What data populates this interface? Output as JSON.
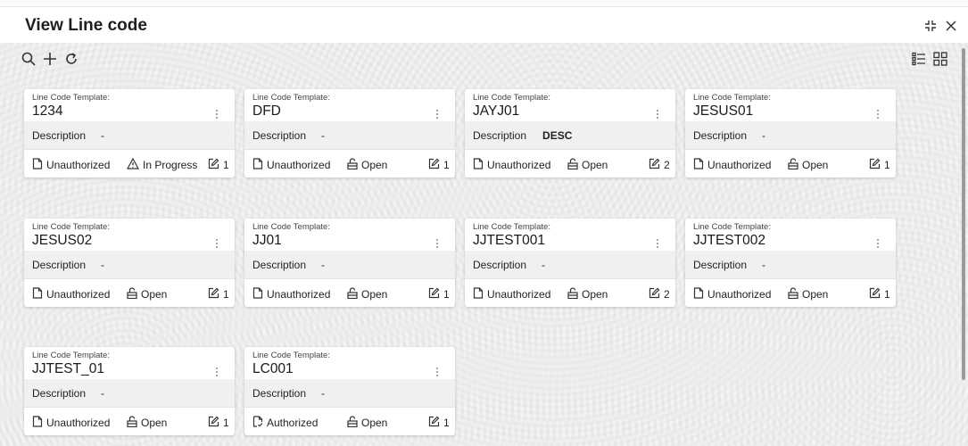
{
  "header": {
    "title": "View Line code"
  },
  "toolbar": {
    "search_icon": "search-icon",
    "add_icon": "plus-icon",
    "refresh_icon": "refresh-icon",
    "list_view_icon": "list-view-icon",
    "grid_view_icon": "grid-view-icon"
  },
  "window": {
    "minimize_icon": "collapse-icon",
    "close_icon": "close-icon"
  },
  "card_label": "Line Code Template:",
  "description_label": "Description",
  "cards": [
    {
      "code": "1234",
      "description": "-",
      "auth": "Unauthorized",
      "status": "In Progress",
      "mods": "1"
    },
    {
      "code": "DFD",
      "description": "-",
      "auth": "Unauthorized",
      "status": "Open",
      "mods": "1"
    },
    {
      "code": "JAYJ01",
      "description": "DESC",
      "auth": "Unauthorized",
      "status": "Open",
      "mods": "2"
    },
    {
      "code": "JESUS01",
      "description": "-",
      "auth": "Unauthorized",
      "status": "Open",
      "mods": "1"
    },
    {
      "code": "JESUS02",
      "description": "-",
      "auth": "Unauthorized",
      "status": "Open",
      "mods": "1"
    },
    {
      "code": "JJ01",
      "description": "-",
      "auth": "Unauthorized",
      "status": "Open",
      "mods": "1"
    },
    {
      "code": "JJTEST001",
      "description": "-",
      "auth": "Unauthorized",
      "status": "Open",
      "mods": "2"
    },
    {
      "code": "JJTEST002",
      "description": "-",
      "auth": "Unauthorized",
      "status": "Open",
      "mods": "1"
    },
    {
      "code": "JJTEST_01",
      "description": "-",
      "auth": "Unauthorized",
      "status": "Open",
      "mods": "1"
    },
    {
      "code": "LC001",
      "description": "-",
      "auth": "Authorized",
      "status": "Open",
      "mods": "1"
    }
  ]
}
